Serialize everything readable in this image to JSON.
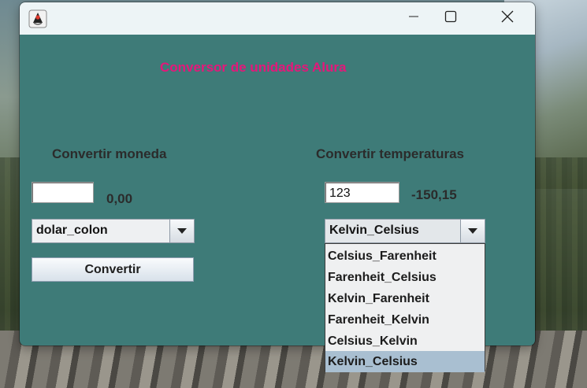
{
  "window": {
    "app_icon": "java-duke-icon",
    "controls": {
      "minimize": "minimize-icon",
      "maximize": "maximize-icon",
      "close": "close-icon"
    }
  },
  "main": {
    "title": "Conversor de unidades Alura",
    "currency": {
      "label": "Convertir moneda",
      "input_value": "",
      "result": "0,00",
      "selected": "dolar_colon",
      "button_label": "Convertir"
    },
    "temperature": {
      "label": "Convertir temperaturas",
      "input_value": "123",
      "result": "-150,15",
      "selected": "Kelvin_Celsius",
      "options": [
        "Celsius_Farenheit",
        "Farenheit_Celsius",
        "Kelvin_Farenheit",
        "Farenheit_Kelvin",
        "Celsius_Kelvin",
        "Kelvin_Celsius"
      ],
      "highlighted_option": "Kelvin_Celsius"
    }
  },
  "colors": {
    "window_bg": "#3e7b78",
    "title_text": "#e5177a",
    "selection_bg": "#a9bfd1"
  }
}
